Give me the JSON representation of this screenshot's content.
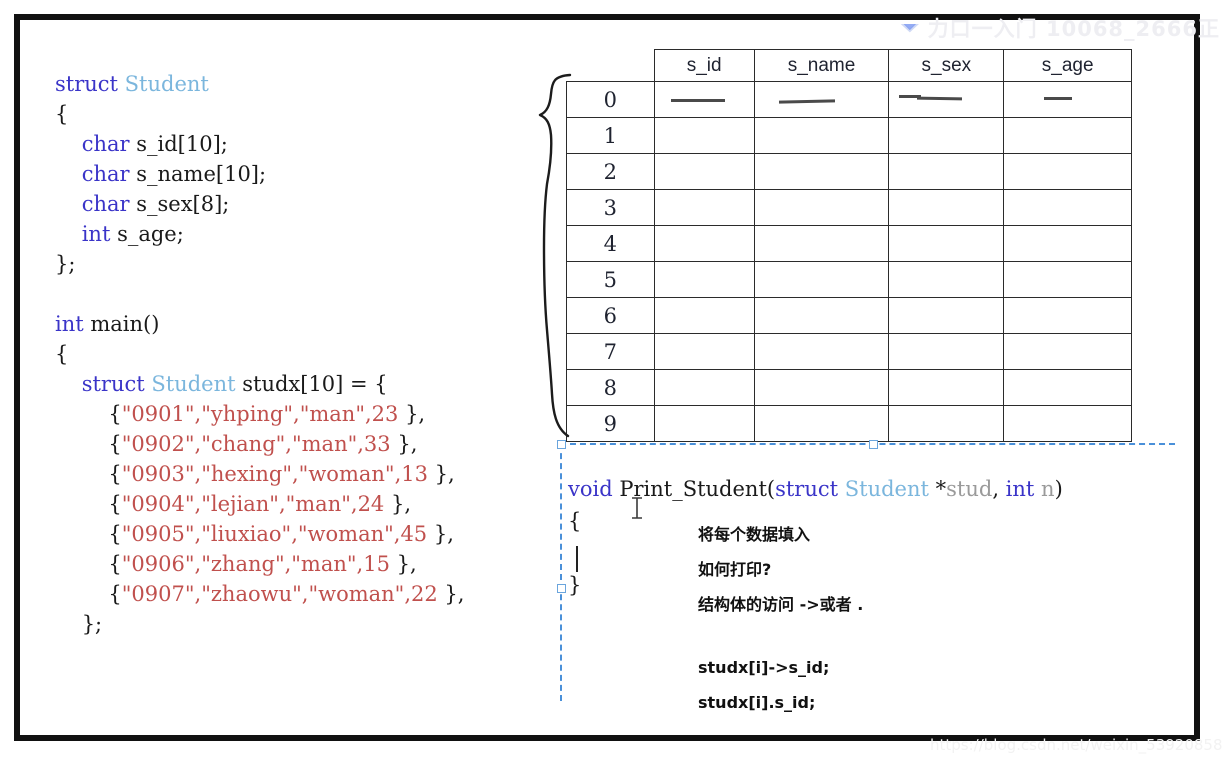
{
  "code_struct": {
    "lines": [
      [
        {
          "t": "struct ",
          "c": "kw"
        },
        {
          "t": "Student",
          "c": "type-id"
        }
      ],
      [
        {
          "t": "{",
          "c": "plain"
        }
      ],
      [
        {
          "t": "    char ",
          "c": "kw"
        },
        {
          "t": "s_id[10];",
          "c": "plain"
        }
      ],
      [
        {
          "t": "    char ",
          "c": "kw"
        },
        {
          "t": "s_name[10];",
          "c": "plain"
        }
      ],
      [
        {
          "t": "    char ",
          "c": "kw"
        },
        {
          "t": "s_sex[8];",
          "c": "plain"
        }
      ],
      [
        {
          "t": "    int ",
          "c": "kw"
        },
        {
          "t": "s_age;",
          "c": "plain"
        }
      ],
      [
        {
          "t": "};",
          "c": "plain"
        }
      ],
      [
        {
          "t": " ",
          "c": "plain"
        }
      ],
      [
        {
          "t": "int ",
          "c": "kw"
        },
        {
          "t": "main()",
          "c": "plain"
        }
      ],
      [
        {
          "t": "{",
          "c": "plain"
        }
      ],
      [
        {
          "t": "    struct ",
          "c": "kw"
        },
        {
          "t": "Student",
          "c": "type-id"
        },
        {
          "t": " studx[10] = {",
          "c": "plain"
        }
      ],
      [
        {
          "t": "        {",
          "c": "plain"
        },
        {
          "t": "\"0901\",\"yhping\",\"man\",23",
          "c": "str"
        },
        {
          "t": " },",
          "c": "plain"
        }
      ],
      [
        {
          "t": "        {",
          "c": "plain"
        },
        {
          "t": "\"0902\",\"chang\",\"man\",33",
          "c": "str"
        },
        {
          "t": " },",
          "c": "plain"
        }
      ],
      [
        {
          "t": "        {",
          "c": "plain"
        },
        {
          "t": "\"0903\",\"hexing\",\"woman\",13",
          "c": "str"
        },
        {
          "t": " },",
          "c": "plain"
        }
      ],
      [
        {
          "t": "        {",
          "c": "plain"
        },
        {
          "t": "\"0904\",\"lejian\",\"man\",24",
          "c": "str"
        },
        {
          "t": " },",
          "c": "plain"
        }
      ],
      [
        {
          "t": "        {",
          "c": "plain"
        },
        {
          "t": "\"0905\",\"liuxiao\",\"woman\",45",
          "c": "str"
        },
        {
          "t": " },",
          "c": "plain"
        }
      ],
      [
        {
          "t": "        {",
          "c": "plain"
        },
        {
          "t": "\"0906\",\"zhang\",\"man\",15",
          "c": "str"
        },
        {
          "t": " },",
          "c": "plain"
        }
      ],
      [
        {
          "t": "        {",
          "c": "plain"
        },
        {
          "t": "\"0907\",\"zhaowu\",\"woman\",22",
          "c": "str"
        },
        {
          "t": " },",
          "c": "plain"
        }
      ],
      [
        {
          "t": "    };",
          "c": "plain"
        }
      ]
    ]
  },
  "code_function": {
    "lines": [
      [
        {
          "t": "void ",
          "c": "kw"
        },
        {
          "t": "Print_Student",
          "c": "plain"
        },
        {
          "t": "(",
          "c": "plain"
        },
        {
          "t": "struct ",
          "c": "kw"
        },
        {
          "t": "Student ",
          "c": "type-id"
        },
        {
          "t": "*",
          "c": "plain"
        },
        {
          "t": "stud",
          "c": "gray"
        },
        {
          "t": ", ",
          "c": "plain"
        },
        {
          "t": "int ",
          "c": "kw"
        },
        {
          "t": "n",
          "c": "gray"
        },
        {
          "t": ")",
          "c": "plain"
        }
      ],
      [
        {
          "t": "{",
          "c": "plain"
        }
      ],
      [
        {
          "t": " ",
          "c": "plain"
        }
      ],
      [
        {
          "t": "}",
          "c": "plain"
        }
      ]
    ]
  },
  "table": {
    "headers": [
      "",
      "s_id",
      "s_name",
      "s_sex",
      "s_age"
    ],
    "row_indices": [
      "0",
      "1",
      "2",
      "3",
      "4",
      "5",
      "6",
      "7",
      "8",
      "9"
    ],
    "row0_marks": [
      "dash",
      "dash",
      "dash",
      "dash"
    ]
  },
  "annotations": {
    "note1": "将每个数据填入",
    "note2": "如何打印?",
    "note3": "结构体的访问 ->或者 .",
    "note4": "studx[i]->s_id;",
    "note5": "studx[i].s_id;"
  },
  "watermarks": {
    "top_text": "力口一入门 10068_2666正",
    "bottom_text": "https://blog.csdn.net/weixin_53920858"
  },
  "colors": {
    "keyword": "#3a34c8",
    "typename": "#7bb6dd",
    "string": "#c0504d",
    "plain": "#1a1a1a",
    "gray": "#9a9a9a",
    "grid_line": "#2b2b2b",
    "selection": "#4a90d9",
    "frame": "#111111"
  }
}
